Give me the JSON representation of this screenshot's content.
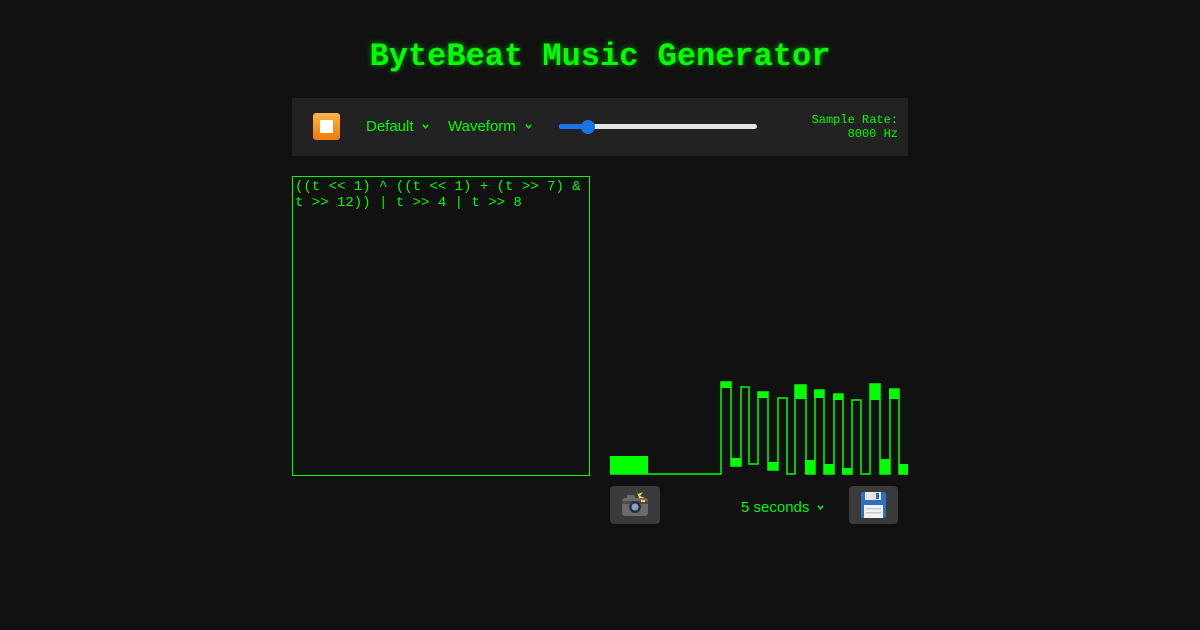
{
  "app": {
    "title": "ByteBeat Music Generator"
  },
  "toolbar": {
    "play_state": "stop",
    "preset_select": {
      "selected": "Default"
    },
    "view_select": {
      "selected": "Waveform"
    },
    "volume_slider": {
      "value": 0.12
    },
    "sample_rate": {
      "label": "Sample Rate:",
      "value": "8000 Hz"
    }
  },
  "editor": {
    "code": "((t << 1) ^ ((t << 1) + (t >> 7) & t >> 12)) | t >> 4 | t >> 8"
  },
  "bottom": {
    "snapshot_icon": "camera-flash-icon",
    "duration_select": {
      "selected": "5 seconds"
    },
    "save_icon": "floppy-disk-icon"
  },
  "colors": {
    "accent": "#00ff00",
    "background": "#111111",
    "toolbar_bg": "#222222",
    "slider_accent": "#1a73e8",
    "play_button": "#f39c12"
  }
}
